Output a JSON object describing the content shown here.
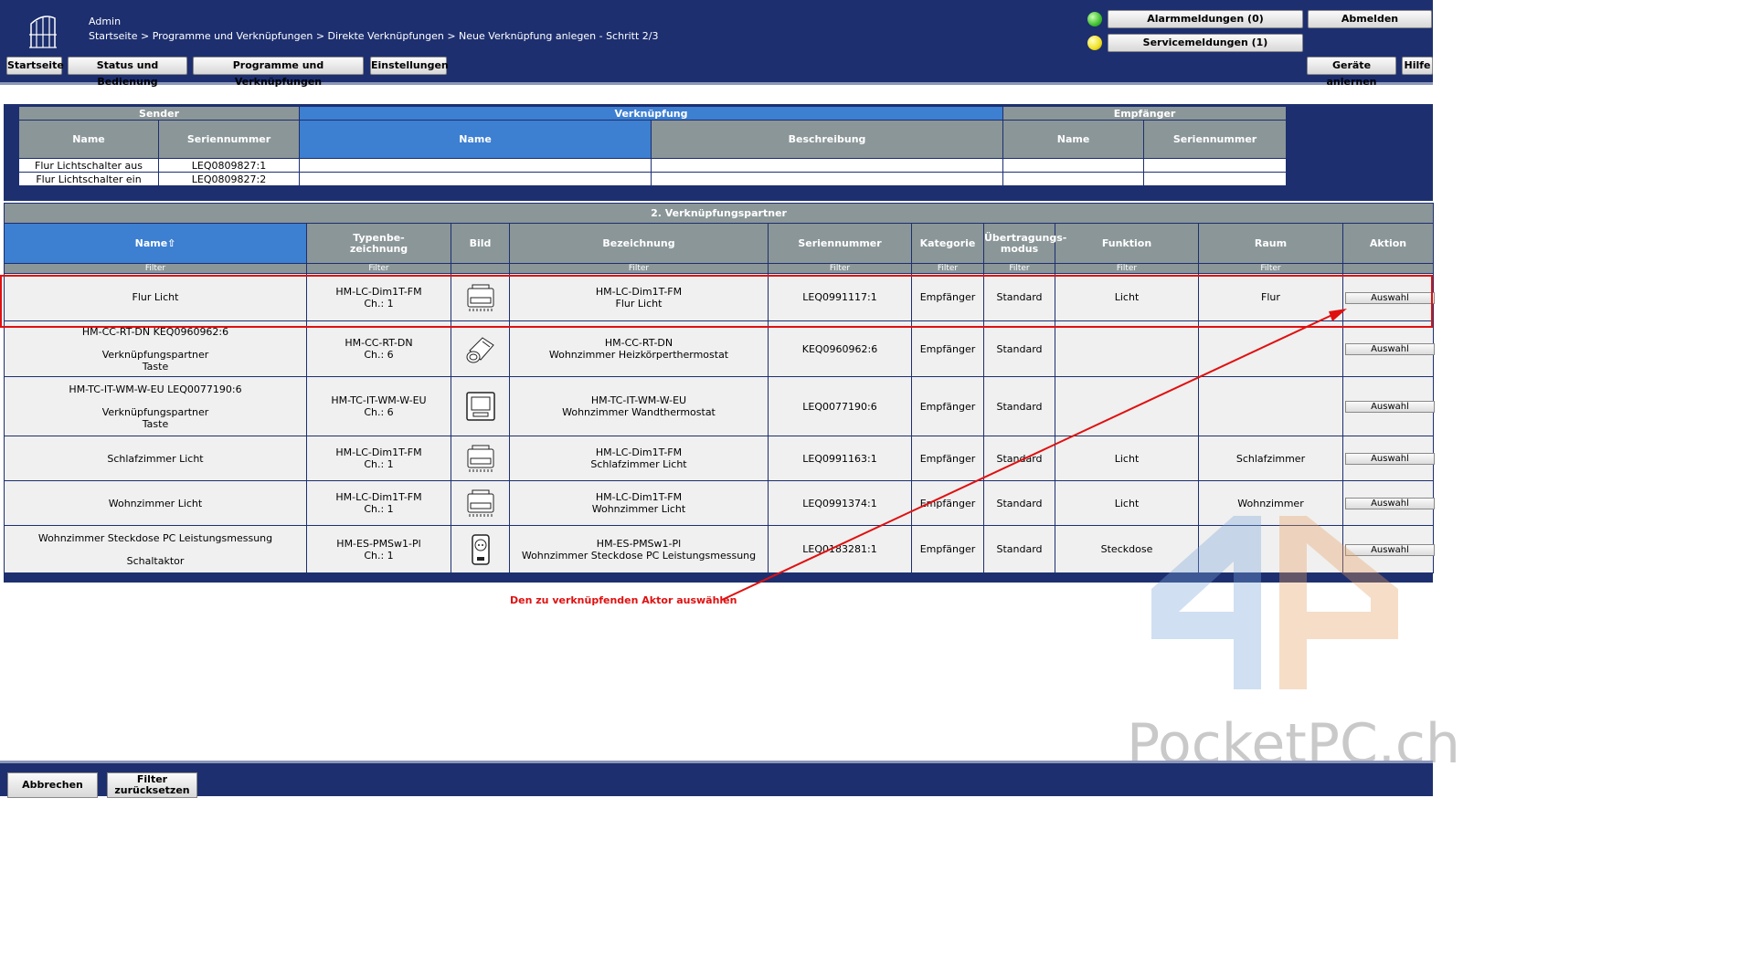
{
  "header": {
    "user": "Admin",
    "breadcrumb": "Startseite > Programme und Verknüpfungen > Direkte Verknüpfungen > Neue Verknüpfung anlegen - Schritt 2/3",
    "alarm_label": "Alarmmeldungen (0)",
    "service_label": "Servicemeldungen (1)",
    "logout_label": "Abmelden",
    "nav": [
      "Startseite",
      "Status und Bedienung",
      "Programme und Verknüpfungen",
      "Einstellungen"
    ],
    "teach_label": "Geräte anlernen",
    "help_label": "Hilfe",
    "alarm_color": "#3fbf2f",
    "service_color": "#f0e020"
  },
  "sender_table": {
    "group_sender": "Sender",
    "group_link": "Verknüpfung",
    "group_receiver": "Empfänger",
    "col_name": "Name",
    "col_serial": "Seriennummer",
    "col_link_name": "Name",
    "col_desc": "Beschreibung",
    "col_rcv_name": "Name",
    "col_rcv_serial": "Seriennummer",
    "rows": [
      {
        "name": "Flur Lichtschalter aus",
        "serial": "LEQ0809827:1"
      },
      {
        "name": "Flur Lichtschalter ein",
        "serial": "LEQ0809827:2"
      }
    ]
  },
  "partner": {
    "title": "2. Verknüpfungspartner",
    "columns": {
      "name": "Name",
      "type": "Typenbe-\nzeichnung",
      "image": "Bild",
      "label": "Bezeichnung",
      "serial": "Seriennummer",
      "category": "Kategorie",
      "mode": "Übertragungs-\nmodus",
      "function": "Funktion",
      "room": "Raum",
      "action": "Aktion"
    },
    "filter_label": "Filter",
    "action_label": "Auswahl",
    "rows": [
      {
        "name1": "Flur Licht",
        "name2": "",
        "name3": "",
        "type": "HM-LC-Dim1T-FM",
        "channel": "Ch.: 1",
        "icon": "dimmer-icon",
        "label1": "HM-LC-Dim1T-FM",
        "label2": "Flur Licht",
        "serial": "LEQ0991117:1",
        "category": "Empfänger",
        "mode": "Standard",
        "function": "Licht",
        "room": "Flur"
      },
      {
        "name1": "HM-CC-RT-DN KEQ0960962:6",
        "name2": "Verknüpfungspartner",
        "name3": "Taste",
        "type": "HM-CC-RT-DN",
        "channel": "Ch.: 6",
        "icon": "radiator-thermostat-icon",
        "label1": "HM-CC-RT-DN",
        "label2": "Wohnzimmer Heizkörperthermostat",
        "serial": "KEQ0960962:6",
        "category": "Empfänger",
        "mode": "Standard",
        "function": "",
        "room": ""
      },
      {
        "name1": "HM-TC-IT-WM-W-EU LEQ0077190:6",
        "name2": "Verknüpfungspartner",
        "name3": "Taste",
        "type": "HM-TC-IT-WM-W-EU",
        "channel": "Ch.: 6",
        "icon": "wall-thermostat-icon",
        "label1": "HM-TC-IT-WM-W-EU",
        "label2": "Wohnzimmer Wandthermostat",
        "serial": "LEQ0077190:6",
        "category": "Empfänger",
        "mode": "Standard",
        "function": "",
        "room": ""
      },
      {
        "name1": "Schlafzimmer Licht",
        "name2": "",
        "name3": "",
        "type": "HM-LC-Dim1T-FM",
        "channel": "Ch.: 1",
        "icon": "dimmer-icon",
        "label1": "HM-LC-Dim1T-FM",
        "label2": "Schlafzimmer Licht",
        "serial": "LEQ0991163:1",
        "category": "Empfänger",
        "mode": "Standard",
        "function": "Licht",
        "room": "Schlafzimmer"
      },
      {
        "name1": "Wohnzimmer Licht",
        "name2": "",
        "name3": "",
        "type": "HM-LC-Dim1T-FM",
        "channel": "Ch.: 1",
        "icon": "dimmer-icon",
        "label1": "HM-LC-Dim1T-FM",
        "label2": "Wohnzimmer Licht",
        "serial": "LEQ0991374:1",
        "category": "Empfänger",
        "mode": "Standard",
        "function": "Licht",
        "room": "Wohnzimmer"
      },
      {
        "name1": "Wohnzimmer Steckdose PC Leistungsmessung",
        "name2": "",
        "name3": "Schaltaktor",
        "type": "HM-ES-PMSw1-Pl",
        "channel": "Ch.: 1",
        "icon": "plug-icon",
        "label1": "HM-ES-PMSw1-Pl",
        "label2": "Wohnzimmer Steckdose PC Leistungsmessung",
        "serial": "LEQ0183281:1",
        "category": "Empfänger",
        "mode": "Standard",
        "function": "Steckdose",
        "room": ""
      }
    ]
  },
  "annotation": "Den zu verknüpfenden Aktor auswählen",
  "footer": {
    "cancel_label": "Abbrechen",
    "reset_label": "Filter\nzurücksetzen"
  },
  "watermark": "PocketPC.ch"
}
